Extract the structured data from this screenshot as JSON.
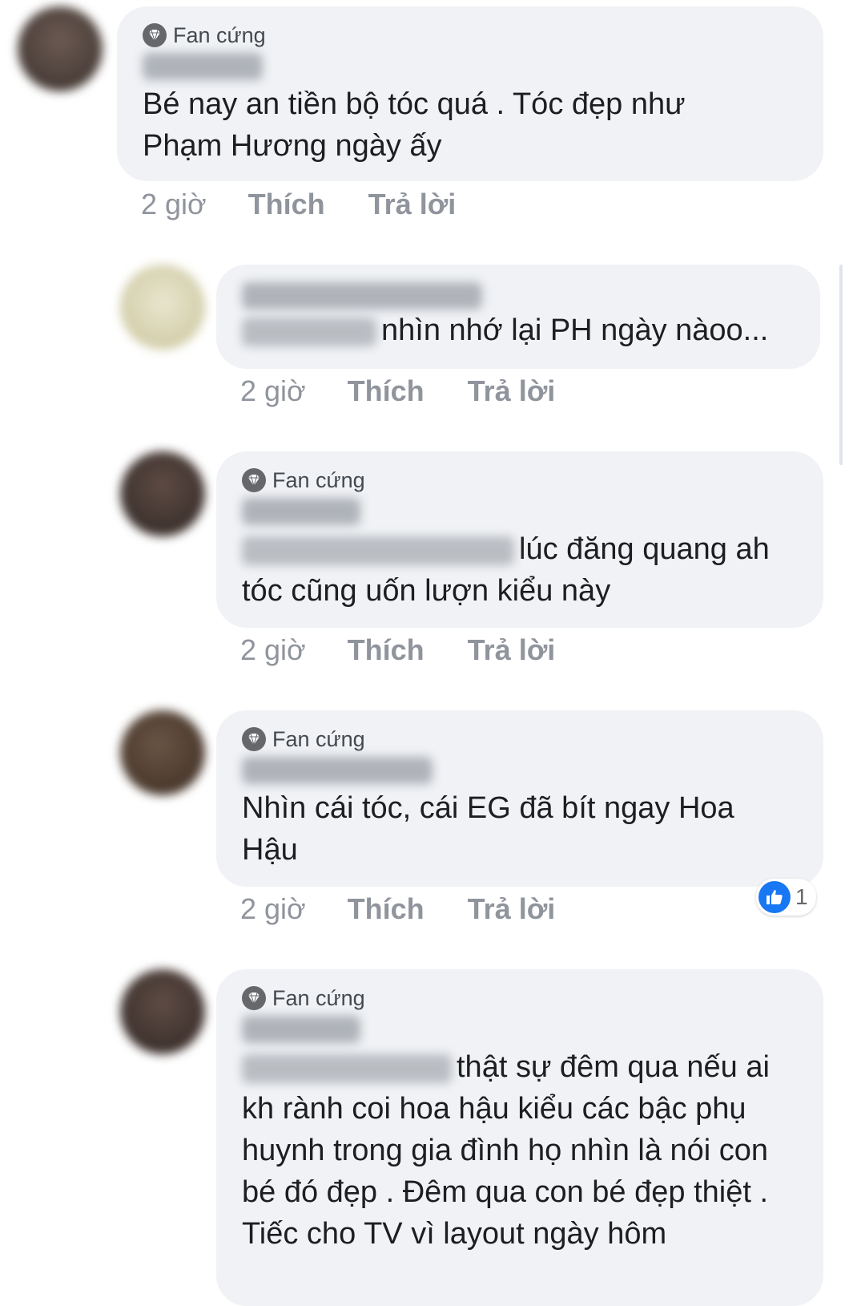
{
  "comments": [
    {
      "badge": "Fan cứng",
      "text": "Bé nay an tiền bộ tóc quá . Tóc đẹp như Phạm Hương ngày ấy",
      "time": "2 giờ",
      "like": "Thích",
      "reply": "Trả lời"
    },
    {
      "text": "nhìn nhớ lại PH ngày nàoo...",
      "time": "2 giờ",
      "like": "Thích",
      "reply": "Trả lời"
    },
    {
      "badge": "Fan cứng",
      "text_line1": "lúc đăng quang ah",
      "text_line2": "tóc cũng uốn lượn kiểu này",
      "time": "2 giờ",
      "like": "Thích",
      "reply": "Trả lời"
    },
    {
      "badge": "Fan cứng",
      "text": "Nhìn cái tóc, cái EG đã bít ngay Hoa Hậu",
      "time": "2 giờ",
      "like": "Thích",
      "reply": "Trả lời",
      "reaction_count": "1"
    },
    {
      "badge": "Fan cứng",
      "text_line1": "thật sự đêm qua nếu ai",
      "text_rest": "kh rành coi hoa hậu kiểu các bậc phụ huynh trong gia đình họ nhìn là nói con bé đó đẹp . Đêm qua con bé đẹp thiệt . Tiếc cho TV vì layout ngày hôm"
    }
  ],
  "colors": {
    "bubble": "#f0f2f5",
    "meta": "#90949c",
    "like_blue": "#1877f2"
  }
}
